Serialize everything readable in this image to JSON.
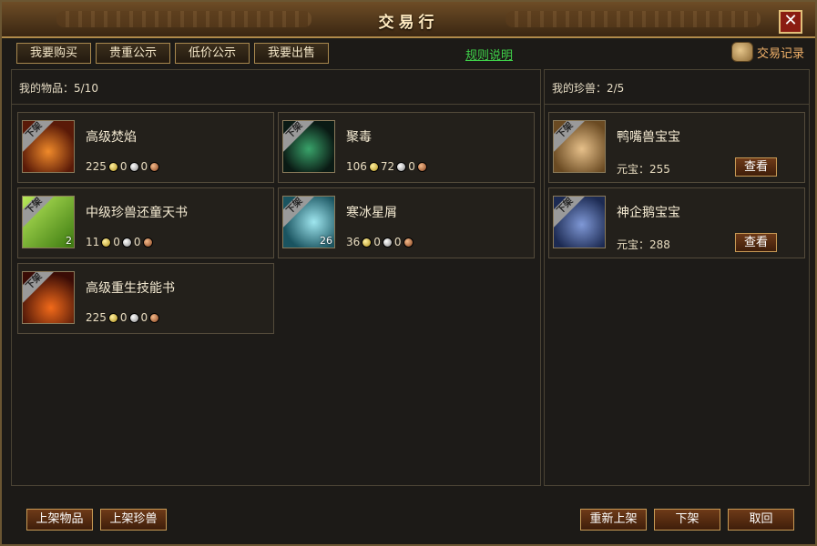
{
  "window": {
    "title": "交易行",
    "close_label": "✕"
  },
  "tabs": [
    {
      "label": "我要购买"
    },
    {
      "label": "贵重公示"
    },
    {
      "label": "低价公示"
    },
    {
      "label": "我要出售"
    }
  ],
  "rules_link": "规则说明",
  "trade_log": "交易记录",
  "items_panel": {
    "header": "我的物品：5/10",
    "items": [
      {
        "name": "高级焚焰",
        "tag": "下架",
        "gold": "225",
        "silver": "0",
        "copper": "0",
        "count": "",
        "icon": "flame-warrior-icon",
        "color": "#c0561a"
      },
      {
        "name": "聚毒",
        "tag": "下架",
        "gold": "106",
        "silver": "72",
        "copper": "0",
        "count": "",
        "icon": "poison-icon",
        "color": "#1f4a34"
      },
      {
        "name": "中级珍兽还童天书",
        "tag": "下架",
        "gold": "11",
        "silver": "0",
        "copper": "0",
        "count": "2",
        "icon": "green-book-icon",
        "color": "#6fb51f"
      },
      {
        "name": "寒冰星屑",
        "tag": "下架",
        "gold": "36",
        "silver": "0",
        "copper": "0",
        "count": "26",
        "icon": "ice-shard-icon",
        "color": "#3aa0b0"
      },
      {
        "name": "高级重生技能书",
        "tag": "下架",
        "gold": "225",
        "silver": "0",
        "copper": "0",
        "count": "",
        "icon": "fire-book-icon",
        "color": "#b8361c"
      }
    ]
  },
  "pets_panel": {
    "header": "我的珍兽：2/5",
    "pets": [
      {
        "name": "鸭嘴兽宝宝",
        "tag": "下架",
        "yuanbao_label": "元宝：",
        "yuanbao": "255",
        "view_label": "查看",
        "icon": "platypus-icon",
        "color": "#c9a36a"
      },
      {
        "name": "神企鹅宝宝",
        "tag": "下架",
        "yuanbao_label": "元宝：",
        "yuanbao": "288",
        "view_label": "查看",
        "icon": "penguin-icon",
        "color": "#3c58a0"
      }
    ]
  },
  "bottom": {
    "list_item": "上架物品",
    "list_pet": "上架珍兽",
    "relist": "重新上架",
    "delist": "下架",
    "cancel": "取回"
  }
}
